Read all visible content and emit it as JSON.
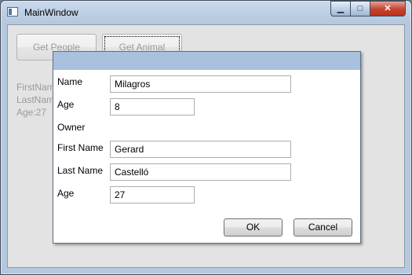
{
  "window": {
    "title": "MainWindow"
  },
  "caption": {
    "minimize": "▁",
    "maximize": "□",
    "close": "✕"
  },
  "main": {
    "get_people_label": "Get People",
    "get_animal_label": "Get Animal",
    "info_lines": [
      "FirstNam",
      "LastNam",
      "Age:27"
    ]
  },
  "dialog": {
    "name_label": "Name",
    "name_value": "Milagros",
    "age_label": "Age",
    "age_value": "8",
    "owner_label": "Owner",
    "first_name_label": "First Name",
    "first_name_value": "Gerard",
    "last_name_label": "Last Name",
    "last_name_value": "Castelló",
    "owner_age_label": "Age",
    "owner_age_value": "27",
    "ok_label": "OK",
    "cancel_label": "Cancel"
  }
}
